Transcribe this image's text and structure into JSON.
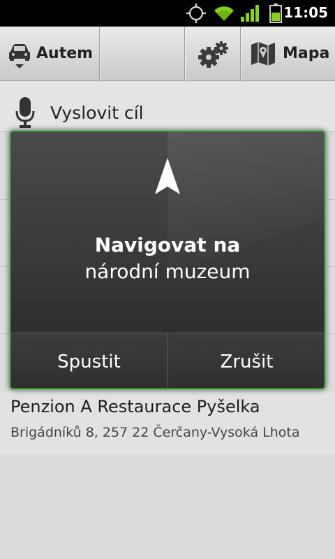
{
  "status_bar": {
    "time": "11:05"
  },
  "toolbar": {
    "mode_label": "Autem",
    "map_label": "Mapa"
  },
  "voice": {
    "label": "Vyslovit cíl"
  },
  "dialog": {
    "title": "Navigovat na",
    "destination": "národní muzeum",
    "start_label": "Spustit",
    "cancel_label": "Zrušit"
  },
  "places": [
    {
      "name": "Penzion A Restaurace Pyšelka",
      "address": "Brigádníků 8, 257 22 Čerčany-Vysoká Lhota"
    }
  ],
  "colors": {
    "dialog_border": "#5fc05f",
    "signal": "#86d11e",
    "battery": "#86d11e"
  }
}
